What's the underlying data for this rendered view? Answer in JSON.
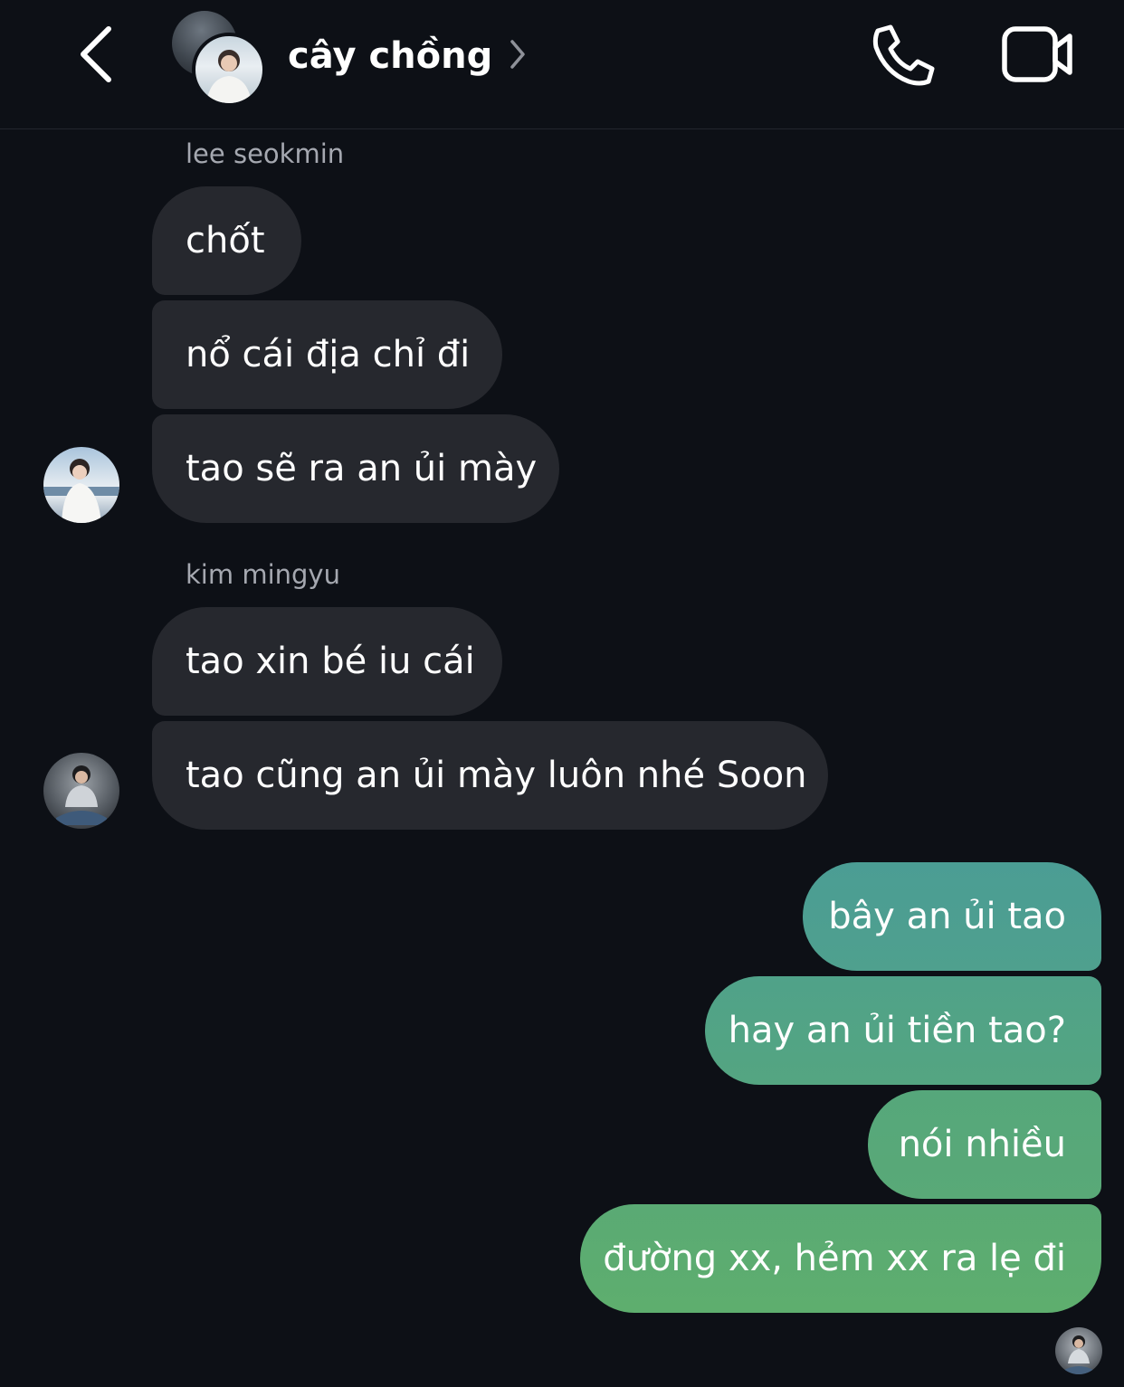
{
  "header": {
    "title": "cây chồng",
    "icons": {
      "back": "chevron-left-icon",
      "title_chevron": "chevron-right-icon",
      "call": "phone-icon",
      "video": "video-camera-icon"
    }
  },
  "messages": {
    "group1": {
      "sender": "lee seokmin",
      "bubbles": [
        "chốt",
        "nổ cái địa chỉ đi",
        "tao sẽ ra an ủi mày"
      ]
    },
    "group2": {
      "sender": "kim mingyu",
      "bubbles": [
        "tao xin bé iu cái",
        "tao cũng an ủi mày luôn nhé Soon"
      ]
    },
    "outgoing": {
      "bubbles": [
        "bây an ủi tao",
        "hay an ủi tiền tao?",
        "nói nhiều",
        "đường xx, hẻm xx ra lẹ đi"
      ]
    }
  },
  "colors": {
    "background": "#0d1016",
    "incoming_bubble": "#26282e",
    "outgoing_gradient_top": "#4a9e96",
    "outgoing_gradient_bottom": "#5fae6c",
    "sender_name": "#a5a8b0"
  }
}
